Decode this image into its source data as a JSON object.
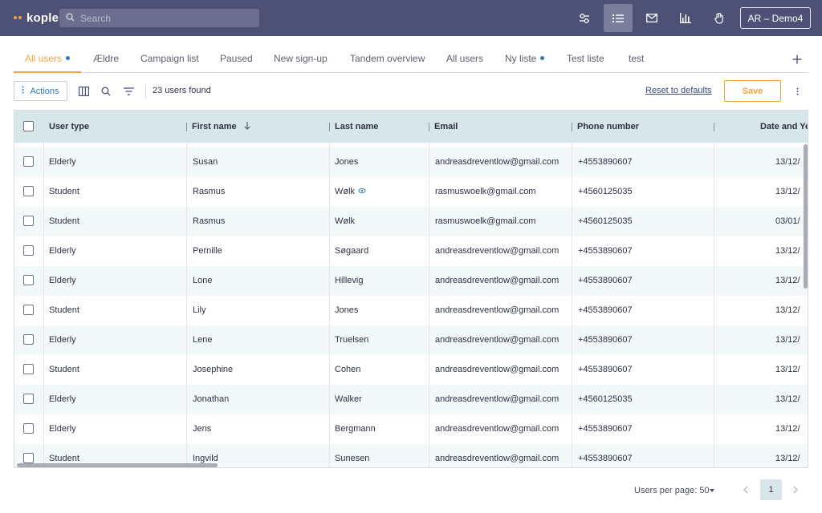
{
  "app": {
    "logo_text": "kople",
    "logo_dot_colors": [
      "#f2a43c",
      "#f2a43c"
    ],
    "search_placeholder": "Search",
    "user_button": "AR – Demo4"
  },
  "nav_icons": [
    {
      "name": "settings-sliders-icon",
      "active": false
    },
    {
      "name": "list-icon",
      "active": true
    },
    {
      "name": "mail-icon",
      "active": false
    },
    {
      "name": "bar-chart-icon",
      "active": false
    },
    {
      "name": "hand-icon",
      "active": false
    }
  ],
  "tabs": [
    {
      "label": "All users",
      "active": true,
      "dot": true
    },
    {
      "label": "Ældre",
      "active": false,
      "dot": false
    },
    {
      "label": "Campaign list",
      "active": false,
      "dot": false
    },
    {
      "label": "Paused",
      "active": false,
      "dot": false
    },
    {
      "label": "New sign-up",
      "active": false,
      "dot": false
    },
    {
      "label": "Tandem overview",
      "active": false,
      "dot": false
    },
    {
      "label": "All users",
      "active": false,
      "dot": false
    },
    {
      "label": "Ny liste",
      "active": false,
      "dot": true
    },
    {
      "label": "Test liste",
      "active": false,
      "dot": false
    },
    {
      "label": "test",
      "active": false,
      "dot": false
    }
  ],
  "toolbar": {
    "actions_label": "Actions",
    "count_text": "23 users found",
    "reset_label": "Reset to defaults",
    "save_label": "Save"
  },
  "table": {
    "columns": [
      "User type",
      "First name",
      "Last name",
      "Email",
      "Phone number",
      "Date and Ye"
    ],
    "sorted_column": "First name",
    "rows": [
      {
        "type": "Elderly",
        "first": "Susan",
        "last": "Jones",
        "email": "andreasdreventlow@gmail.com",
        "phone": "+4553890607",
        "date": "13/12/",
        "badge": false
      },
      {
        "type": "Student",
        "first": "Rasmus",
        "last": "Wølk",
        "email": "rasmuswoelk@gmail.com",
        "phone": "+4560125035",
        "date": "13/12/",
        "badge": true
      },
      {
        "type": "Student",
        "first": "Rasmus",
        "last": "Wølk",
        "email": "rasmuswoelk@gmail.com",
        "phone": "+4560125035",
        "date": "03/01/",
        "badge": false
      },
      {
        "type": "Elderly",
        "first": "Pernille",
        "last": "Søgaard",
        "email": "andreasdreventlow@gmail.com",
        "phone": "+4553890607",
        "date": "13/12/",
        "badge": false
      },
      {
        "type": "Elderly",
        "first": "Lone",
        "last": "Hillevig",
        "email": "andreasdreventlow@gmail.com",
        "phone": "+4553890607",
        "date": "13/12/",
        "badge": false
      },
      {
        "type": "Student",
        "first": "Lily",
        "last": "Jones",
        "email": "andreasdreventlow@gmail.com",
        "phone": "+4553890607",
        "date": "13/12/",
        "badge": false
      },
      {
        "type": "Elderly",
        "first": "Lene",
        "last": "Truelsen",
        "email": "andreasdreventlow@gmail.com",
        "phone": "+4553890607",
        "date": "13/12/",
        "badge": false
      },
      {
        "type": "Student",
        "first": "Josephine",
        "last": "Cohen",
        "email": "andreasdreventlow@gmail.com",
        "phone": "+4553890607",
        "date": "13/12/",
        "badge": false
      },
      {
        "type": "Elderly",
        "first": "Jonathan",
        "last": "Walker",
        "email": "andreasdreventlow@gmail.com",
        "phone": "+4560125035",
        "date": "13/12/",
        "badge": false
      },
      {
        "type": "Elderly",
        "first": "Jens",
        "last": "Bergmann",
        "email": "andreasdreventlow@gmail.com",
        "phone": "+4553890607",
        "date": "13/12/",
        "badge": false
      },
      {
        "type": "Student",
        "first": "Ingvild",
        "last": "Sunesen",
        "email": "andreasdreventlow@gmail.com",
        "phone": "+4553890607",
        "date": "13/12/",
        "badge": false
      }
    ]
  },
  "footer": {
    "per_page_text": "Users per page: 50",
    "current_page": "1"
  },
  "colors": {
    "topbar": "#4d5175",
    "accent": "#f2a43c",
    "header_row": "#d7e6e8",
    "dot_blue": "#2f77b5"
  }
}
